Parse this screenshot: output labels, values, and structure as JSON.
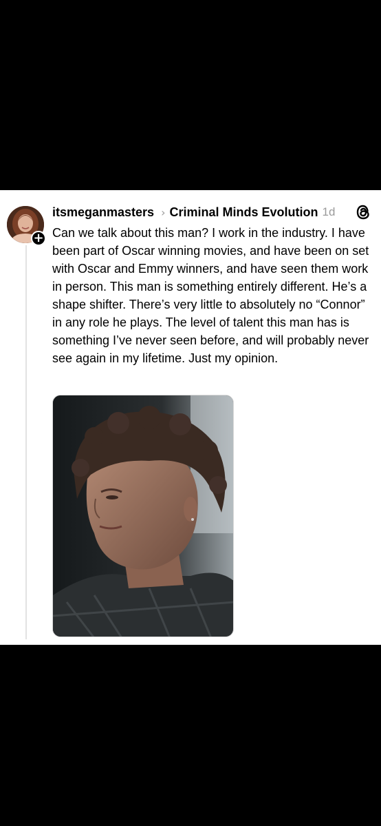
{
  "post": {
    "username": "itsmeganmasters",
    "community": "Criminal Minds Evolution",
    "time": "1d",
    "text": "Can we talk about this man? I work in the industry. I have been part of Oscar winning movies, and have been on set with Oscar and Emmy winners, and have seen them work in person. This man is something entirely different. He’s a shape shifter. There’s very little to absolutely no “Connor” in any role he plays. The level of talent this man has is something I’ve never seen before, and will probably never see again in my lifetime. Just my opinion.",
    "follow_symbol": "+",
    "separator_icon": "chevron-right-icon",
    "app_icon": "threads-logo-icon",
    "image_description_icon": "photo"
  }
}
